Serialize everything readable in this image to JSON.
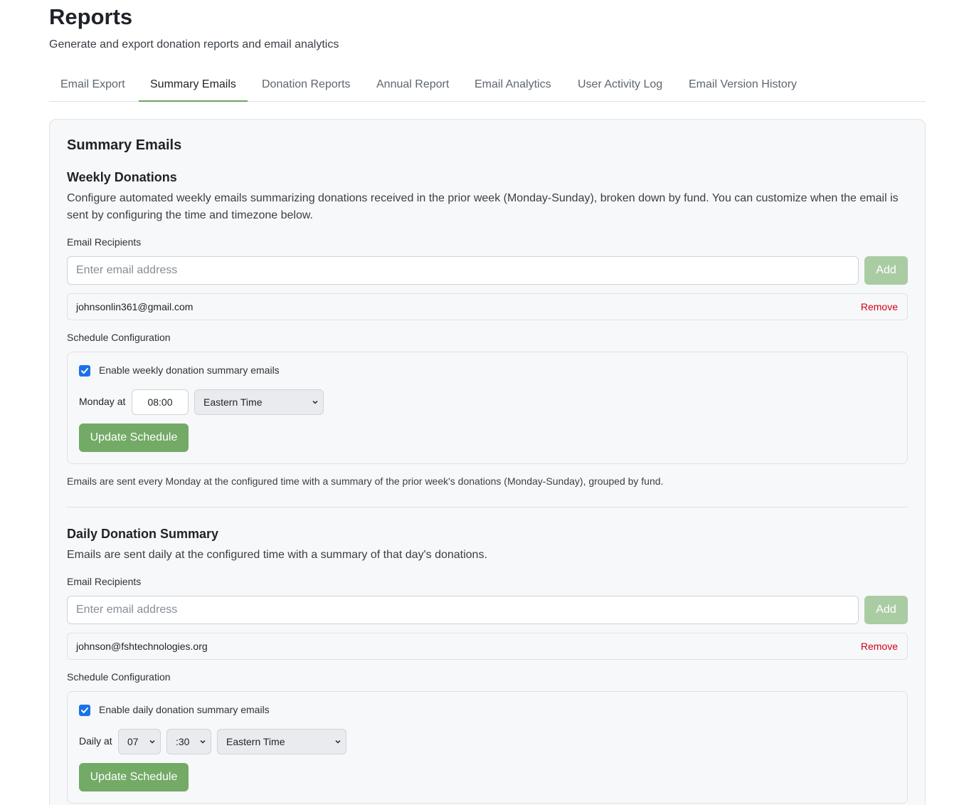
{
  "header": {
    "title": "Reports",
    "subtitle": "Generate and export donation reports and email analytics"
  },
  "tabs": [
    {
      "label": "Email Export",
      "active": false
    },
    {
      "label": "Summary Emails",
      "active": true
    },
    {
      "label": "Donation Reports",
      "active": false
    },
    {
      "label": "Annual Report",
      "active": false
    },
    {
      "label": "Email Analytics",
      "active": false
    },
    {
      "label": "User Activity Log",
      "active": false
    },
    {
      "label": "Email Version History",
      "active": false
    }
  ],
  "card": {
    "title": "Summary Emails",
    "weekly": {
      "title": "Weekly Donations",
      "description": "Configure automated weekly emails summarizing donations received in the prior week (Monday-Sunday), broken down by fund. You can customize when the email is sent by configuring the time and timezone below.",
      "recipients_label": "Email Recipients",
      "email_placeholder": "Enter email address",
      "add_label": "Add",
      "recipients": [
        {
          "email": "johnsonlin361@gmail.com",
          "remove_label": "Remove"
        }
      ],
      "schedule_label": "Schedule Configuration",
      "enable_label": "Enable weekly donation summary emails",
      "enabled": true,
      "day_label": "Monday at",
      "time_value": "08:00",
      "timezone": "Eastern Time",
      "update_label": "Update Schedule",
      "note": "Emails are sent every Monday at the configured time with a summary of the prior week's donations (Monday-Sunday), grouped by fund."
    },
    "daily": {
      "title": "Daily Donation Summary",
      "description": "Emails are sent daily at the configured time with a summary of that day's donations.",
      "recipients_label": "Email Recipients",
      "email_placeholder": "Enter email address",
      "add_label": "Add",
      "recipients": [
        {
          "email": "johnson@fshtechnologies.org",
          "remove_label": "Remove"
        }
      ],
      "schedule_label": "Schedule Configuration",
      "enable_label": "Enable daily donation summary emails",
      "enabled": true,
      "day_label": "Daily at",
      "hour_value": "07",
      "minute_value": ":30",
      "timezone": "Eastern Time",
      "update_label": "Update Schedule"
    }
  },
  "colors": {
    "accent": "#72aa66",
    "accent_disabled": "#a9cca2",
    "tab_underline": "#6ea463",
    "checkbox": "#1a73e8",
    "remove": "#d0021b"
  },
  "icons": {
    "checkbox": "check-icon",
    "select": "chevron-down-icon"
  }
}
